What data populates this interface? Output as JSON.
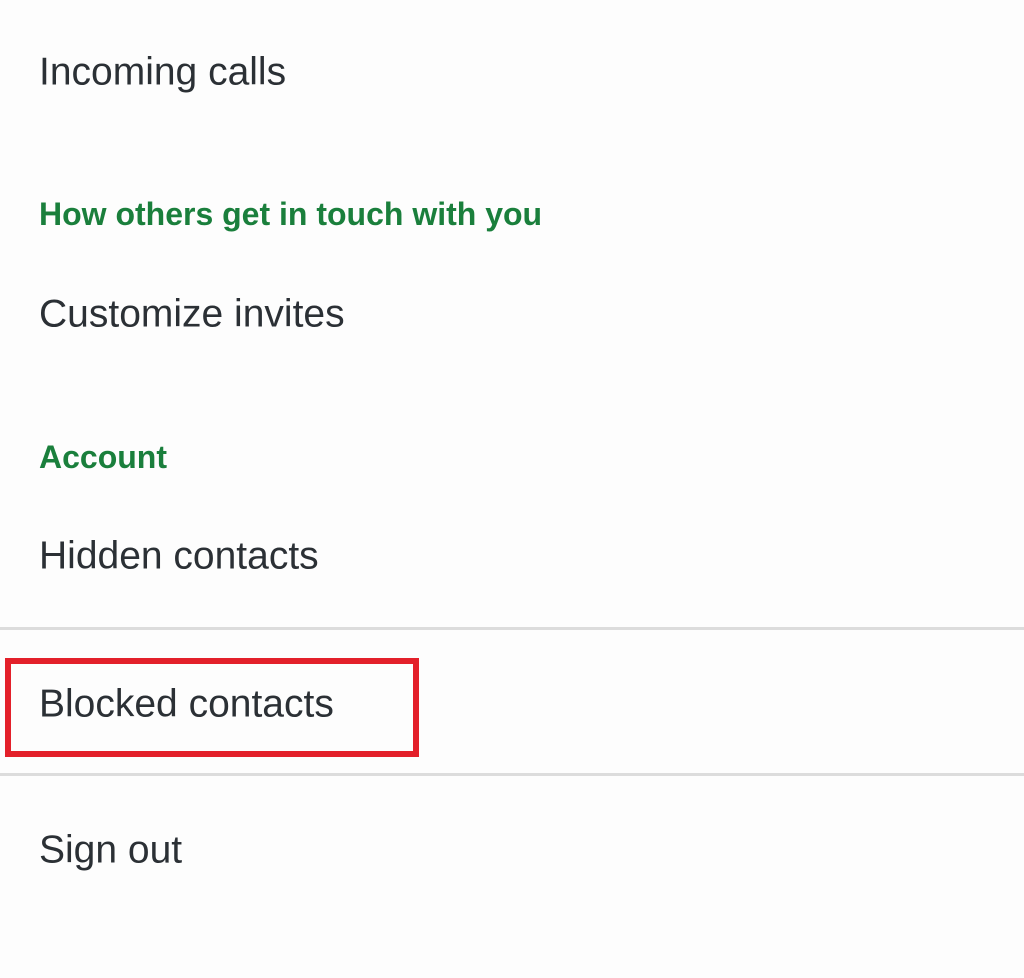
{
  "settings": {
    "items": [
      {
        "type": "item",
        "label": "Incoming calls"
      },
      {
        "type": "header",
        "label": "How others get in touch with you"
      },
      {
        "type": "item",
        "label": "Customize invites"
      },
      {
        "type": "header",
        "label": "Account"
      },
      {
        "type": "item",
        "label": "Hidden contacts"
      },
      {
        "type": "item",
        "label": "Blocked contacts",
        "highlighted": true
      },
      {
        "type": "item",
        "label": "Sign out"
      }
    ]
  },
  "colors": {
    "section_header": "#1a7f3c",
    "text": "#2b3035",
    "highlight_box": "#e3202a"
  }
}
